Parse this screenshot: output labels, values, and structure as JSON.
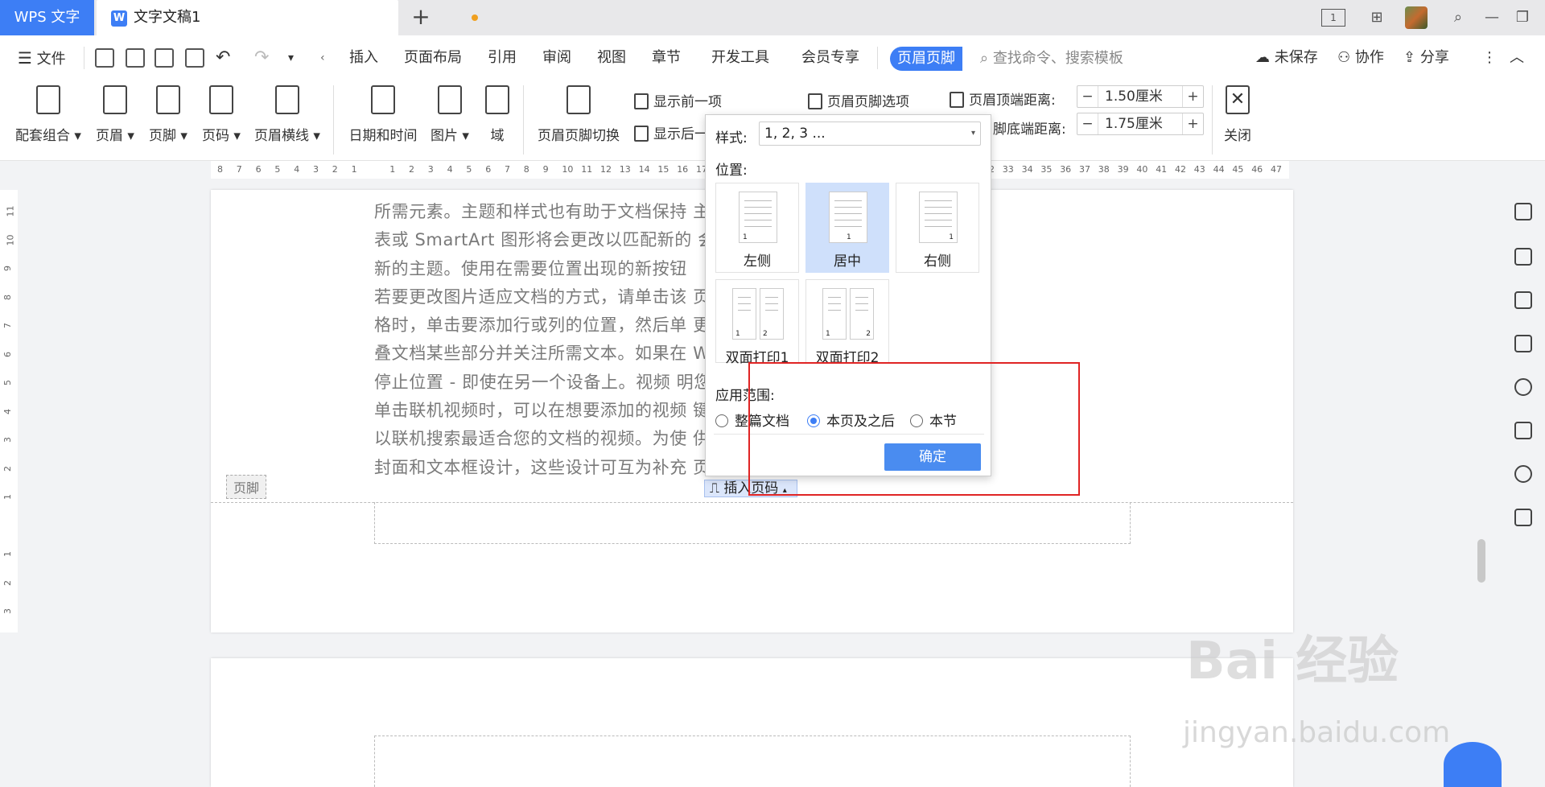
{
  "titlebar": {
    "app_tab": "WPS 文字",
    "doc_tab": "文字文稿1",
    "new_tab_icon": "+",
    "page_indicator": "1"
  },
  "menubar": {
    "file": "文件",
    "items": [
      "插入",
      "页面布局",
      "引用",
      "审阅",
      "视图",
      "章节",
      "开发工具",
      "会员专享"
    ],
    "active_tab": "页眉页脚",
    "search_placeholder": "查找命令、搜索模板",
    "unsaved": "未保存",
    "collab": "协作",
    "share": "分享"
  },
  "ribbon": {
    "combo": "配套组合",
    "header": "页眉",
    "footer": "页脚",
    "page_number": "页码",
    "header_line": "页眉横线",
    "datetime": "日期和时间",
    "picture": "图片",
    "field": "域",
    "switch": "页眉页脚切换",
    "show_prev": "显示前一项",
    "show_next": "显示后一",
    "hf_options": "页眉页脚选项",
    "top_dist_label": "页眉顶端距离:",
    "top_dist_value": "1.50厘米",
    "bottom_dist_label": "脚底端距离:",
    "bottom_dist_value": "1.75厘米",
    "close": "关闭"
  },
  "document": {
    "lines": [
      "所需元素。主题和样式也有助于文档保持                    主题时，图片、图",
      "表或 SmartArt 图形将会更改以匹配新的                    会进行更改以匹配",
      "新的主题。使用在需要位置出现的新按钮",
      "若要更改图片适应文档的方式，请单击该                    页按钮。当处理表",
      "格时，单击要添加行或列的位置，然后单                    更加容易。可以折",
      "叠文档某些部分并关注所需文本。如果在                  Word 会记住您的",
      "停止位置 - 即使在另一个设备上。视频                    明您的观点。当您",
      "单击联机视频时，可以在想要添加的视频                    键入一个关键字",
      "以联机搜索最适合您的文档的视频。为使                    供了页眉、页脚、",
      "封面和文本框设计，这些设计可互为补充                    页眉和提要栏。"
    ],
    "footer_tag": "页脚",
    "insert_page_number": "插入页码"
  },
  "popup": {
    "style_label": "样式:",
    "style_value": "1, 2, 3 ...",
    "position_label": "位置:",
    "positions": [
      "左侧",
      "居中",
      "右侧",
      "双面打印1",
      "双面打印2"
    ],
    "selected_position": "居中",
    "scope_label": "应用范围:",
    "scope_options": [
      "整篇文档",
      "本页及之后",
      "本节"
    ],
    "selected_scope": "本页及之后",
    "ok": "确定"
  },
  "ruler": {
    "h_ticks": [
      "8",
      "7",
      "6",
      "5",
      "4",
      "3",
      "2",
      "1",
      "",
      "1",
      "2",
      "3",
      "4",
      "5",
      "6",
      "7",
      "8",
      "9",
      "10",
      "11",
      "12",
      "13",
      "14",
      "15",
      "16",
      "17",
      "18",
      "19",
      "20",
      "21",
      "22",
      "23",
      "24",
      "25",
      "26",
      "27",
      "28",
      "29",
      "30",
      "31",
      "32",
      "33",
      "34",
      "35",
      "36",
      "37",
      "38",
      "39",
      "40",
      "41",
      "42",
      "43",
      "44",
      "45",
      "46",
      "47"
    ],
    "v_ticks": [
      "11",
      "10",
      "9",
      "8",
      "7",
      "6",
      "5",
      "4",
      "3",
      "2",
      "1",
      "",
      "1",
      "2",
      "3"
    ]
  },
  "watermark": {
    "text": "Bai 经验",
    "url": "jingyan.baidu.com"
  },
  "colors": {
    "accent": "#3d7ef5",
    "highlight_box": "#e02424",
    "selected_card": "#cfe0fb"
  }
}
